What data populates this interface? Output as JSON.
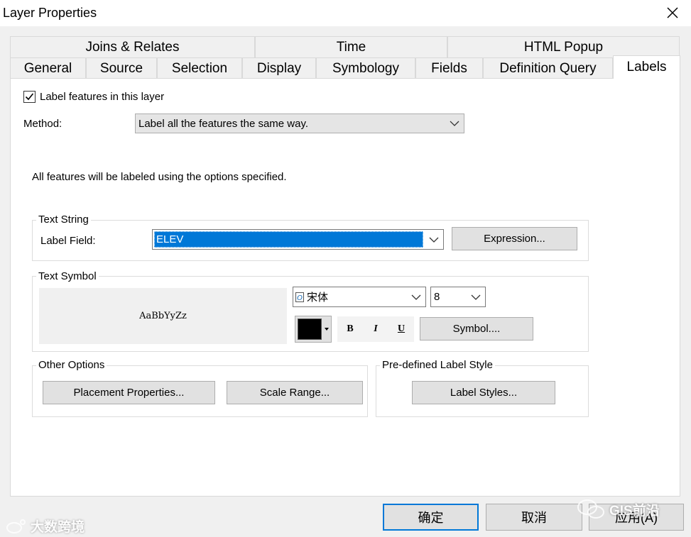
{
  "window": {
    "title": "Layer Properties"
  },
  "tabs": {
    "row1": [
      {
        "label": "Joins & Relates"
      },
      {
        "label": "Time"
      },
      {
        "label": "HTML Popup"
      }
    ],
    "row2": [
      {
        "label": "General"
      },
      {
        "label": "Source"
      },
      {
        "label": "Selection"
      },
      {
        "label": "Display"
      },
      {
        "label": "Symbology"
      },
      {
        "label": "Fields"
      },
      {
        "label": "Definition Query"
      },
      {
        "label": "Labels",
        "active": true
      }
    ]
  },
  "labels": {
    "label_features": {
      "label": "Label features in this layer",
      "checked": true
    },
    "method": {
      "label": "Method:",
      "value": "Label all the features the same way."
    },
    "info_text": "All features will be labeled using the options specified.",
    "text_string": {
      "title": "Text String",
      "label_field_label": "Label Field:",
      "label_field_value": "ELEV",
      "expression_button": "Expression..."
    },
    "text_symbol": {
      "title": "Text Symbol",
      "preview_text": "AaBbYyZz",
      "font": "宋体",
      "font_size": "8",
      "color": "#000000",
      "bold": "B",
      "italic": "I",
      "underline": "U",
      "symbol_button": "Symbol...."
    },
    "other_options": {
      "title": "Other Options",
      "placement_button": "Placement Properties...",
      "scale_range_button": "Scale Range..."
    },
    "predefined": {
      "title": "Pre-defined Label Style",
      "label_styles_button": "Label Styles..."
    }
  },
  "footer": {
    "ok": "确定",
    "cancel": "取消",
    "apply": "应用(A)"
  },
  "watermarks": {
    "left": "大数跨境",
    "right": "GIS前沿"
  }
}
